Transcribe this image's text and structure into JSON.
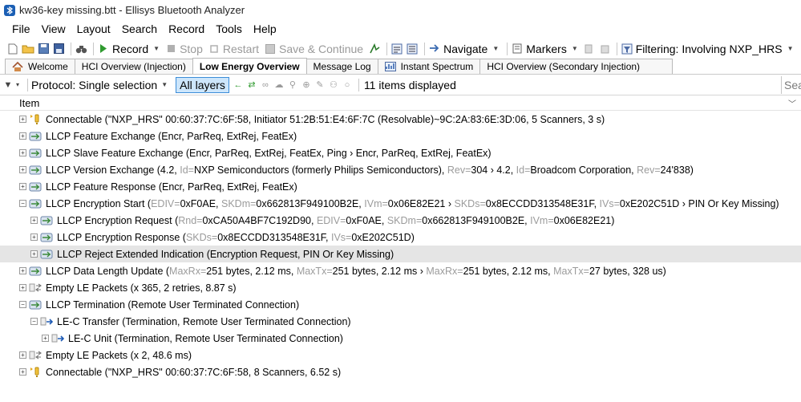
{
  "window": {
    "title": "kw36-key missing.btt - Ellisys Bluetooth Analyzer"
  },
  "menu": [
    "File",
    "View",
    "Layout",
    "Search",
    "Record",
    "Tools",
    "Help"
  ],
  "toolbar": {
    "record": "Record",
    "stop": "Stop",
    "restart": "Restart",
    "save_continue": "Save & Continue",
    "navigate": "Navigate",
    "markers": "Markers",
    "filtering": "Filtering: Involving NXP_HRS"
  },
  "tabs": [
    "Welcome",
    "HCI Overview (Injection)",
    "Low Energy Overview",
    "Message Log",
    "Instant Spectrum",
    "HCI Overview (Secondary Injection)"
  ],
  "active_tab": "Low Energy Overview",
  "filterbar": {
    "protocol": "Protocol: Single selection",
    "all_layers": "All layers",
    "items_displayed": "11 items displayed",
    "search_placeholder": "Sea"
  },
  "column": {
    "item": "Item"
  },
  "rows": [
    {
      "kind": "connectable",
      "parts": [
        [
          "Connectable (\"NXP_HRS\" 00:60:37:7C:6F:58, Initiator 51:2B:51:E4:6F:7C (Resolvable)~9C:2A:83:6E:3D:06, 5 Scanners, 3 s)",
          false
        ]
      ]
    },
    {
      "kind": "llcp",
      "parts": [
        [
          "LLCP Feature Exchange (Encr, ParReq, ExtRej, FeatEx)",
          false
        ]
      ]
    },
    {
      "kind": "llcp",
      "parts": [
        [
          "LLCP Slave Feature Exchange (Encr, ParReq, ExtRej, FeatEx, Ping › Encr, ParReq, ExtRej, FeatEx)",
          false
        ]
      ]
    },
    {
      "kind": "llcp",
      "parts": [
        [
          "LLCP Version Exchange (4.2, ",
          false
        ],
        [
          "Id=",
          true
        ],
        [
          "NXP Semiconductors (formerly Philips Semiconductors), ",
          false
        ],
        [
          "Rev=",
          true
        ],
        [
          "304 › 4.2, ",
          false
        ],
        [
          "Id=",
          true
        ],
        [
          "Broadcom Corporation, ",
          false
        ],
        [
          "Rev=",
          true
        ],
        [
          "24'838)",
          false
        ]
      ]
    },
    {
      "kind": "llcp",
      "parts": [
        [
          "LLCP Feature Response (Encr, ParReq, ExtRej, FeatEx)",
          false
        ]
      ]
    },
    {
      "kind": "llcp",
      "expanded": true,
      "parts": [
        [
          "LLCP Encryption Start (",
          false
        ],
        [
          "EDIV=",
          true
        ],
        [
          "0xF0AE, ",
          false
        ],
        [
          "SKDm=",
          true
        ],
        [
          "0x662813F949100B2E, ",
          false
        ],
        [
          "IVm=",
          true
        ],
        [
          "0x06E82E21 › ",
          false
        ],
        [
          "SKDs=",
          true
        ],
        [
          "0x8ECCDD313548E31F, ",
          false
        ],
        [
          "IVs=",
          true
        ],
        [
          "0xE202C51D › PIN Or Key Missing)",
          false
        ]
      ]
    },
    {
      "kind": "llcp-child",
      "parts": [
        [
          "LLCP Encryption Request (",
          false
        ],
        [
          "Rnd=",
          true
        ],
        [
          "0xCA50A4BF7C192D90, ",
          false
        ],
        [
          "EDIV=",
          true
        ],
        [
          "0xF0AE, ",
          false
        ],
        [
          "SKDm=",
          true
        ],
        [
          "0x662813F949100B2E, ",
          false
        ],
        [
          "IVm=",
          true
        ],
        [
          "0x06E82E21)",
          false
        ]
      ]
    },
    {
      "kind": "llcp-child",
      "parts": [
        [
          "LLCP Encryption Response (",
          false
        ],
        [
          "SKDs=",
          true
        ],
        [
          "0x8ECCDD313548E31F, ",
          false
        ],
        [
          "IVs=",
          true
        ],
        [
          "0xE202C51D)",
          false
        ]
      ]
    },
    {
      "kind": "llcp-child",
      "selected": true,
      "parts": [
        [
          "LLCP Reject Extended Indication (Encryption Request, PIN Or Key Missing)",
          false
        ]
      ]
    },
    {
      "kind": "llcp",
      "parts": [
        [
          "LLCP Data Length Update (",
          false
        ],
        [
          "MaxRx=",
          true
        ],
        [
          "251 bytes, 2.12 ms, ",
          false
        ],
        [
          "MaxTx=",
          true
        ],
        [
          "251 bytes, 2.12 ms › ",
          false
        ],
        [
          "MaxRx=",
          true
        ],
        [
          "251 bytes, 2.12 ms, ",
          false
        ],
        [
          "MaxTx=",
          true
        ],
        [
          "27 bytes, 328 us)",
          false
        ]
      ]
    },
    {
      "kind": "empty",
      "parts": [
        [
          "Empty LE Packets (x 365, 2 retries, 8.87 s)",
          false
        ]
      ]
    },
    {
      "kind": "llcp",
      "expanded": true,
      "parts": [
        [
          "LLCP Termination (Remote User Terminated Connection)",
          false
        ]
      ]
    },
    {
      "kind": "lec-transfer",
      "expanded": true,
      "parts": [
        [
          "LE-C Transfer (Termination, Remote User Terminated Connection)",
          false
        ]
      ]
    },
    {
      "kind": "lec-unit",
      "parts": [
        [
          "LE-C Unit (Termination, Remote User Terminated Connection)",
          false
        ]
      ]
    },
    {
      "kind": "empty",
      "parts": [
        [
          "Empty LE Packets (x 2, 48.6 ms)",
          false
        ]
      ]
    },
    {
      "kind": "connectable",
      "parts": [
        [
          "Connectable (\"NXP_HRS\" 00:60:37:7C:6F:58, 8 Scanners, 6.52 s)",
          false
        ]
      ]
    }
  ]
}
